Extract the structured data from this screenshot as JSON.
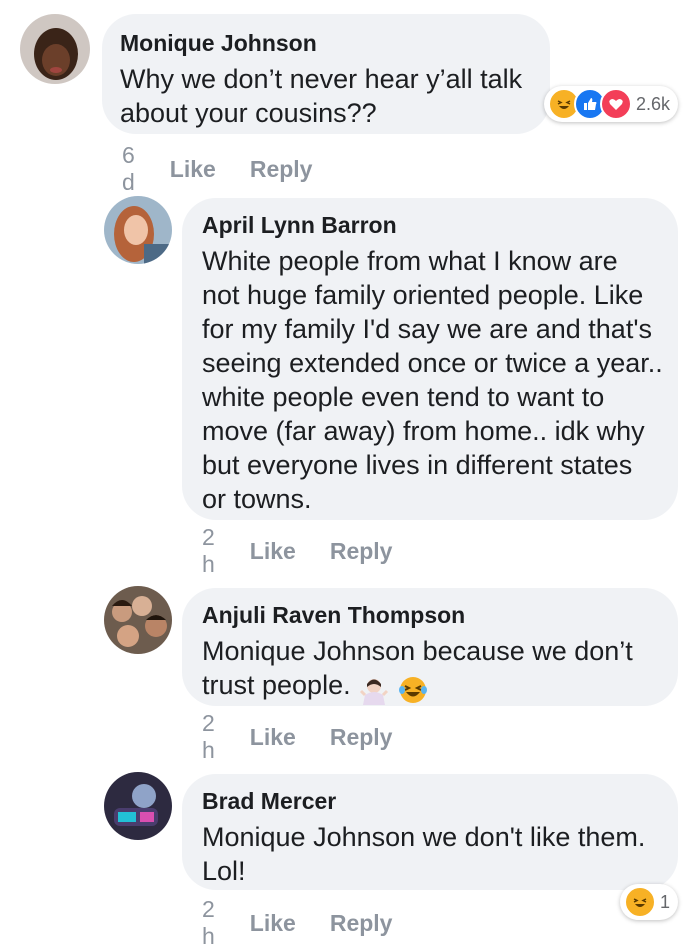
{
  "comments": [
    {
      "author": "Monique Johnson",
      "text": "Why we don’t never hear y’all talk\nabout your cousins??",
      "time": "6 d",
      "like_label": "Like",
      "reply_label": "Reply",
      "reactions": {
        "types": [
          "haha",
          "like",
          "love"
        ],
        "count": "2.6k"
      },
      "avatar_color": "#3a2418"
    },
    {
      "author": "April Lynn Barron",
      "text": "White people from what I know are\nnot huge family oriented people. Like\nfor my family I'd say we are and that's\nseeing extended once or twice a year..\nwhite people even tend to want to\nmove (far away) from home.. idk why\nbut everyone lives in different states\nor towns.",
      "time": "2 h",
      "like_label": "Like",
      "reply_label": "Reply",
      "avatar_color": "#c98f6b"
    },
    {
      "author": "Anjuli Raven Thompson",
      "text": "Monique Johnson because we don’t\ntrust people.",
      "emojis": [
        "person-shrugging",
        "laughing-tears"
      ],
      "time": "2 h",
      "like_label": "Like",
      "reply_label": "Reply",
      "avatar_color": "#5a4a3e"
    },
    {
      "author": "Brad Mercer",
      "text": "Monique Johnson we don't like them.\nLol!",
      "time": "2 h",
      "like_label": "Like",
      "reply_label": "Reply",
      "reactions": {
        "types": [
          "haha"
        ],
        "count": "1"
      },
      "avatar_color": "#2d2a40"
    }
  ]
}
